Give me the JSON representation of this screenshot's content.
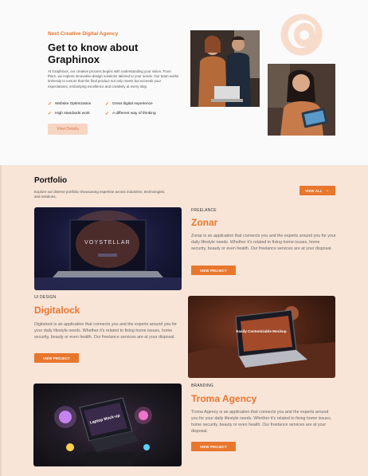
{
  "about": {
    "kicker": "Next Creative Digital Agency",
    "title": "Get to know about Graphinox",
    "description": "At Graphinox, our creative process begins with understanding your vision. From there, we explore innovative design solutions tailored to your needs. Our team works tirelessly to ensure that the final product not only meets but exceeds your expectations, embodying excellence and creativity at every step.",
    "features": [
      "Website Optimization",
      "Great digital experience",
      "High standards work",
      "A different way of thinking"
    ],
    "button": "View Details"
  },
  "portfolio": {
    "title": "Portfolio",
    "subtitle": "Explore our diverse portfolio showcasing expertise across industries, technologies, and solutions.",
    "view_all": "VIEW ALL",
    "projects": [
      {
        "category": "FREELANCE",
        "title": "Zonar",
        "description": "Zonar is an application that connects you and the experts around you for your daily lifestyle needs. Whether it's related to fixing home issues, home security, beauty or even health. Our freelance services are at your disposal.",
        "button": "VIEW PROJECT",
        "image_text": "VOYSTELLAR"
      },
      {
        "category": "UI DESIGN",
        "title": "Digitalock",
        "description": "Digitalock is an application that connects you and the experts around you for your daily lifestyle needs. Whether it's related to fixing home issues, home security, beauty or even health. Our freelance services are at your disposal.",
        "button": "VIEW PROJECT",
        "image_text": "Easily Customizable Mockup"
      },
      {
        "category": "BRANDING",
        "title": "Troma Agency",
        "description": "Troma Agency is an application that connects you and the experts around you for your daily lifestyle needs. Whether it's related to fixing home issues, home security, beauty or even health. Our freelance services are at your disposal.",
        "button": "VIEW PROJECT",
        "image_text": "Laptop Mock-up"
      }
    ]
  },
  "colors": {
    "accent": "#e8772e",
    "peach_bg": "#f9e5d8",
    "soft_button": "#f6d5c3"
  }
}
